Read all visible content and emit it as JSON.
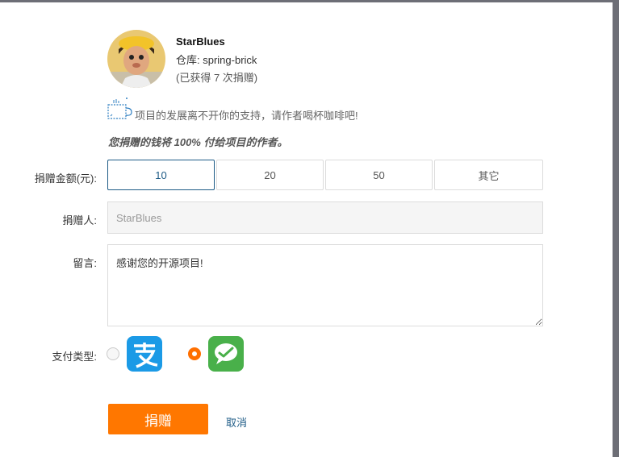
{
  "author": {
    "name": "StarBlues",
    "repo": "仓库: spring-brick",
    "donations": "(已获得 7 次捐赠)"
  },
  "intro": {
    "message": "项目的发展离不开你的支持，请作者喝杯咖啡吧!",
    "notice": "您捐赠的钱将 100% 付给项目的作者。"
  },
  "form": {
    "amount_label": "捐赠金额(元):",
    "amounts": [
      "10",
      "20",
      "50",
      "其它"
    ],
    "selected_amount": "10",
    "donor_label": "捐赠人:",
    "donor_value": "StarBlues",
    "message_label": "留言:",
    "message_value": "感谢您的开源项目!",
    "payment_label": "支付类型:",
    "payment_methods": [
      {
        "icon": "alipay-icon",
        "selected": false
      },
      {
        "icon": "wechat-pay-icon",
        "selected": true
      }
    ],
    "submit_label": "捐赠",
    "cancel_label": "取消"
  },
  "colors": {
    "accent": "#ff7700",
    "selected_border": "#1e5b86",
    "alipay": "#1b9ae6",
    "wechat": "#49b04a"
  }
}
